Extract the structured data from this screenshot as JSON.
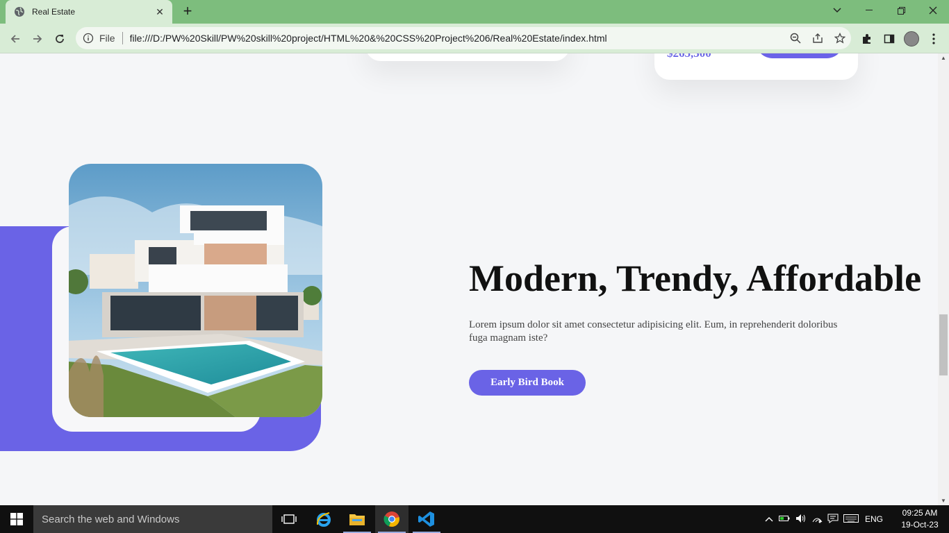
{
  "browser": {
    "tab_title": "Real Estate",
    "address_scheme": "File",
    "address_url": "file:///D:/PW%20Skill/PW%20skill%20project/HTML%20&%20CSS%20Project%206/Real%20Estate/index.html"
  },
  "page": {
    "partial_price": "$265,300",
    "hero": {
      "title": "Modern, Trendy, Affordable",
      "description": "Lorem ipsum dolor sit amet consectetur adipisicing elit. Eum, in reprehenderit doloribus fuga magnam iste?",
      "button_label": "Early Bird Book"
    },
    "colors": {
      "accent": "#6a63e6",
      "background": "#f5f6f8"
    }
  },
  "taskbar": {
    "search_placeholder": "Search the web and Windows",
    "language": "ENG",
    "time": "09:25 AM",
    "date": "19-Oct-23"
  }
}
